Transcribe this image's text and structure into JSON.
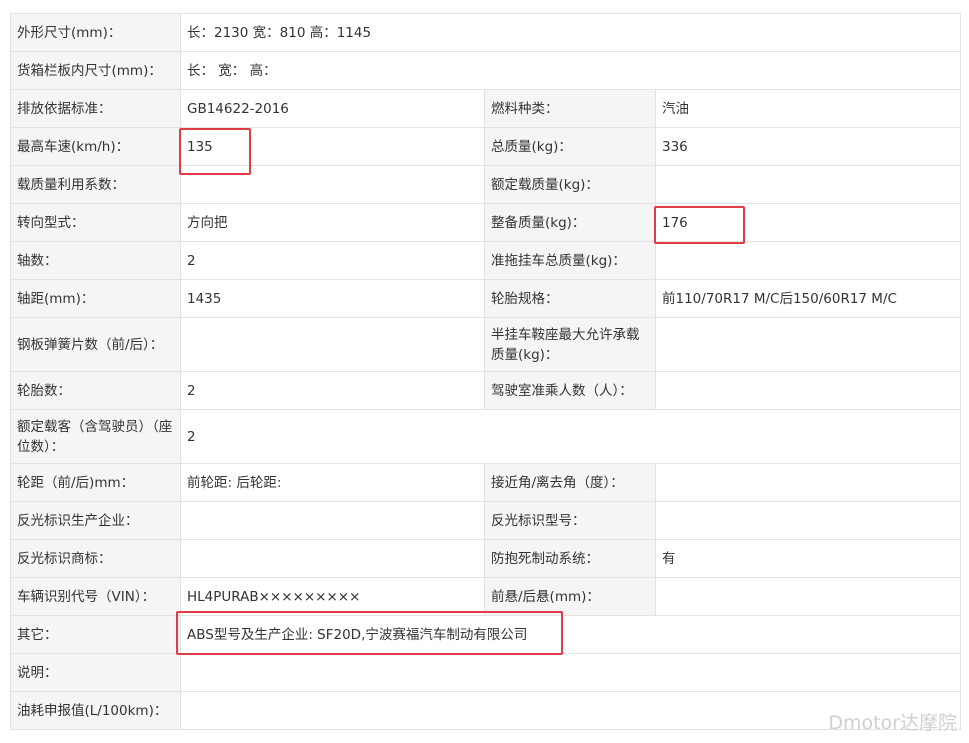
{
  "spec_table": {
    "rows": [
      {
        "label": "外形尺寸(mm)：",
        "value": "长：2130 宽：810 高：1145",
        "full": true
      },
      {
        "label": "货箱栏板内尺寸(mm)：",
        "value": "长：  宽：  高：",
        "full": true
      },
      {
        "label": "排放依据标准：",
        "value": "GB14622-2016",
        "label2": "燃料种类：",
        "value2": "汽油"
      },
      {
        "label": "最高车速(km/h)：",
        "value": "135",
        "label2": "总质量(kg)：",
        "value2": "336"
      },
      {
        "label": "载质量利用系数：",
        "value": "",
        "label2": "额定载质量(kg)：",
        "value2": ""
      },
      {
        "label": "转向型式：",
        "value": "方向把",
        "label2": "整备质量(kg)：",
        "value2": "176"
      },
      {
        "label": "轴数：",
        "value": "2",
        "label2": "准拖挂车总质量(kg)：",
        "value2": ""
      },
      {
        "label": "轴距(mm)：",
        "value": "1435",
        "label2": "轮胎规格：",
        "value2": "前110/70R17 M/C后150/60R17 M/C"
      },
      {
        "label": "钢板弹簧片数（前/后）：",
        "value": "",
        "label2": "半挂车鞍座最大允许承载质量(kg)：",
        "value2": ""
      },
      {
        "label": "轮胎数：",
        "value": "2",
        "label2": "驾驶室准乘人数（人）：",
        "value2": ""
      },
      {
        "label": "额定载客（含驾驶员）（座位数）：",
        "value": "2",
        "full": true
      },
      {
        "label": "轮距（前/后)mm：",
        "value": "前轮距: 后轮距:",
        "label2": "接近角/离去角（度）：",
        "value2": ""
      },
      {
        "label": "反光标识生产企业：",
        "value": "",
        "label2": "反光标识型号：",
        "value2": ""
      },
      {
        "label": "反光标识商标：",
        "value": "",
        "label2": "防抱死制动系统：",
        "value2": "有"
      },
      {
        "label": "车辆识别代号（VIN）：",
        "value": "HL4PURAB×××××××××",
        "label2": "前悬/后悬(mm)：",
        "value2": ""
      },
      {
        "label": "其它：",
        "value": "ABS型号及生产企业: SF20D,宁波赛福汽车制动有限公司",
        "full": true
      },
      {
        "label": "说明：",
        "value": "",
        "full": true
      },
      {
        "label": "油耗申报值(L/100km)：",
        "value": "",
        "full": true
      }
    ]
  },
  "highlight_color": "#e33b46",
  "watermark": "Dmotor达摩院"
}
